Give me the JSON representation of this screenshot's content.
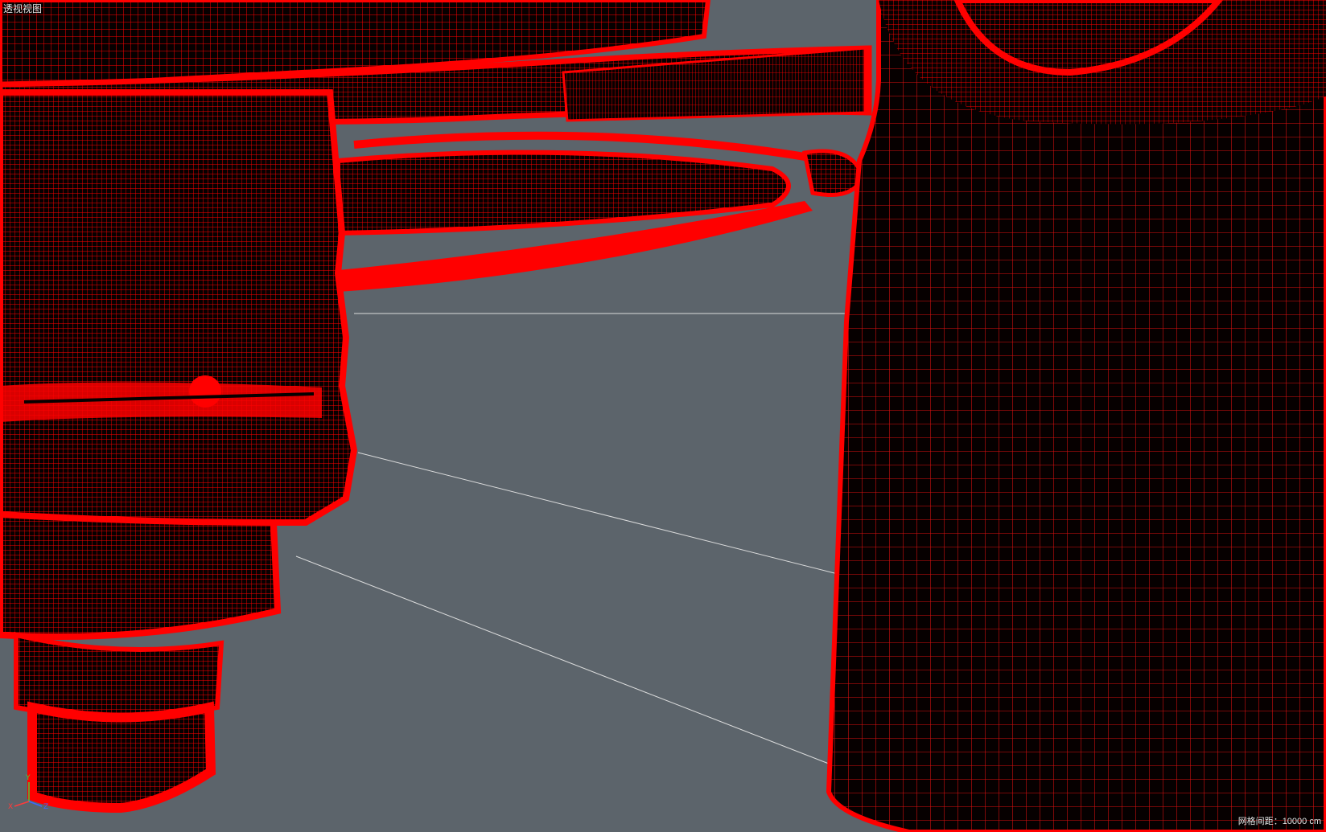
{
  "viewport": {
    "name": "透视视图",
    "shading_mode": "wireframe",
    "background_color": "#5c646b"
  },
  "scene": {
    "wire_color": "#ff0000",
    "body_color": "#060000",
    "guide_line_color": "#e8e8e8"
  },
  "status": {
    "grid_spacing_label": "网格间距",
    "grid_spacing_separator": "：",
    "grid_spacing_value": "10000 cm"
  },
  "axis_gizmo": {
    "x_label": "X",
    "y_label": "Y",
    "z_label": "Z",
    "x_color": "#ff3b3b",
    "y_color": "#40d040",
    "z_color": "#3b6bff"
  }
}
